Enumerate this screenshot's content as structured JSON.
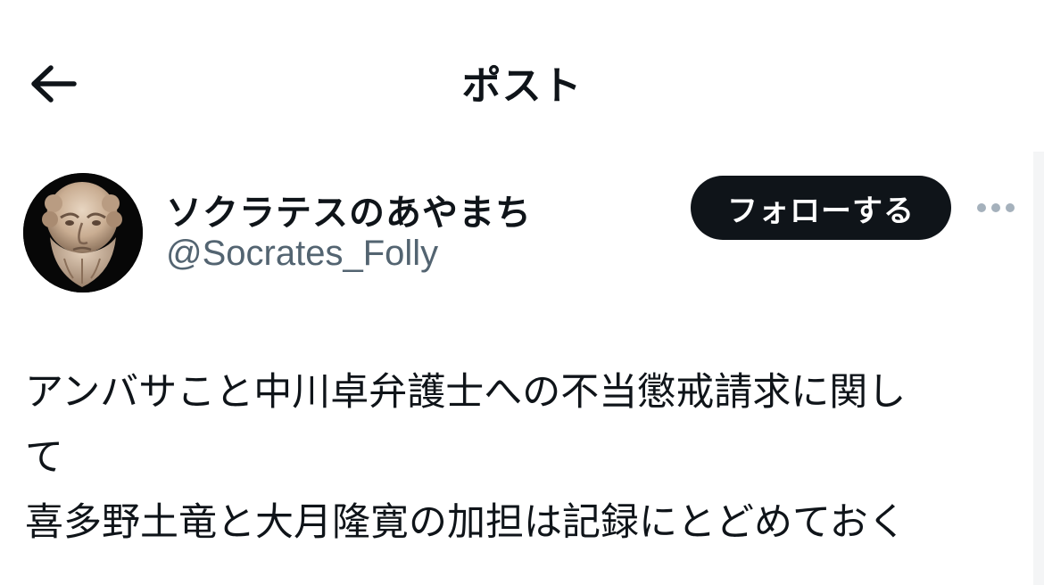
{
  "header": {
    "title": "ポスト",
    "back_icon": "arrow-left-icon"
  },
  "author": {
    "display_name": "ソクラテスのあやまち",
    "handle": "@Socrates_Folly",
    "avatar_alt": "Socrates bust avatar"
  },
  "actions": {
    "follow_label": "フォローする",
    "more_icon": "more-horizontal-icon"
  },
  "tweet": {
    "lines": [
      "アンバサこと中川卓弁護士への不当懲戒請求に関し",
      "て",
      "喜多野土竜と大月隆寛の加担は記録にとどめておく"
    ]
  },
  "colors": {
    "text": "#0f1419",
    "secondary": "#536471",
    "button_bg": "#0f1419",
    "button_text": "#ffffff",
    "more_dots": "#a5b1bc"
  }
}
